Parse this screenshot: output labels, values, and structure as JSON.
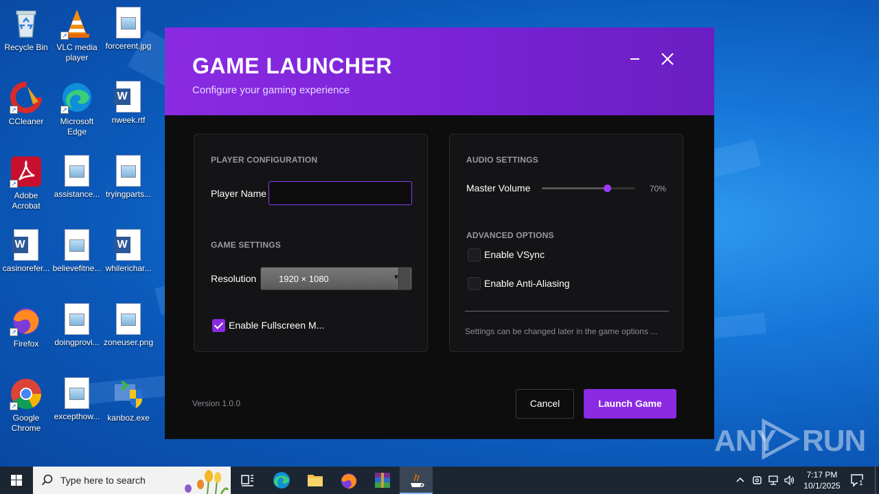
{
  "desktop": {
    "icons": [
      {
        "label": "Recycle Bin"
      },
      {
        "label": "VLC media player"
      },
      {
        "label": "forcerent.jpg"
      },
      {
        "label": "CCleaner"
      },
      {
        "label": "Microsoft Edge"
      },
      {
        "label": "nweek.rtf"
      },
      {
        "label": "Adobe Acrobat"
      },
      {
        "label": "assistance..."
      },
      {
        "label": "tryingparts..."
      },
      {
        "label": "casinorefer..."
      },
      {
        "label": "believefitne..."
      },
      {
        "label": "whilerichar..."
      },
      {
        "label": "Firefox"
      },
      {
        "label": "doingprovi..."
      },
      {
        "label": "zoneuser.png"
      },
      {
        "label": "Google Chrome"
      },
      {
        "label": "excepthow..."
      },
      {
        "label": "kanboz.exe"
      }
    ]
  },
  "launcher": {
    "title": "GAME LAUNCHER",
    "subtitle": "Configure your gaming experience",
    "player_config": {
      "heading": "PLAYER CONFIGURATION",
      "player_name_label": "Player Name",
      "player_name_value": ""
    },
    "game_settings": {
      "heading": "GAME SETTINGS",
      "resolution_label": "Resolution",
      "resolution_value": "1920 × 1080",
      "fullscreen_label": "Enable Fullscreen M...",
      "fullscreen_checked": true
    },
    "audio_settings": {
      "heading": "AUDIO SETTINGS",
      "master_volume_label": "Master Volume",
      "master_volume_value": "70%",
      "master_volume_fraction": 0.7
    },
    "advanced_options": {
      "heading": "ADVANCED OPTIONS",
      "vsync_label": "Enable VSync",
      "vsync_checked": false,
      "antialiasing_label": "Enable Anti-Aliasing",
      "antialiasing_checked": false
    },
    "note": "Settings can be changed later in the game options ...",
    "version": "Version 1.0.0",
    "cancel_label": "Cancel",
    "launch_label": "Launch Game",
    "accent_color": "#8a2be2"
  },
  "watermark": {
    "left": "ANY",
    "right": "RUN"
  },
  "taskbar": {
    "search_placeholder": "Type here to search",
    "time": "7:17 PM",
    "date": "10/1/2025",
    "notification_count": "1"
  }
}
